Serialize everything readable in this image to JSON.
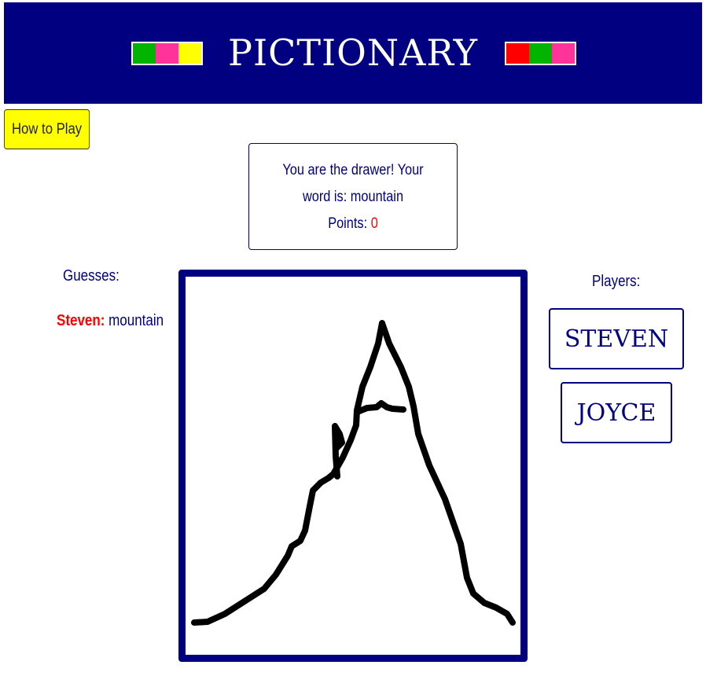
{
  "header": {
    "title": "PICTIONARY",
    "left_swatches": [
      "#00b400",
      "#ff3399",
      "#ffff00"
    ],
    "right_swatches": [
      "#ff0000",
      "#00b400",
      "#ff3399"
    ],
    "background": "#000080"
  },
  "help_button": {
    "label": "How to Play"
  },
  "status": {
    "line1": "You are the drawer! Your",
    "line2": "word is: mountain",
    "points_label": "Points:",
    "points_value": "0"
  },
  "guesses": {
    "heading": "Guesses:",
    "items": [
      {
        "name": "Steven:",
        "guess": "mountain"
      }
    ]
  },
  "players": {
    "heading": "Players:",
    "items": [
      "STEVEN",
      "JOYCE"
    ]
  },
  "canvas": {
    "stroke_color": "#000000",
    "frame_color": "#000080"
  }
}
